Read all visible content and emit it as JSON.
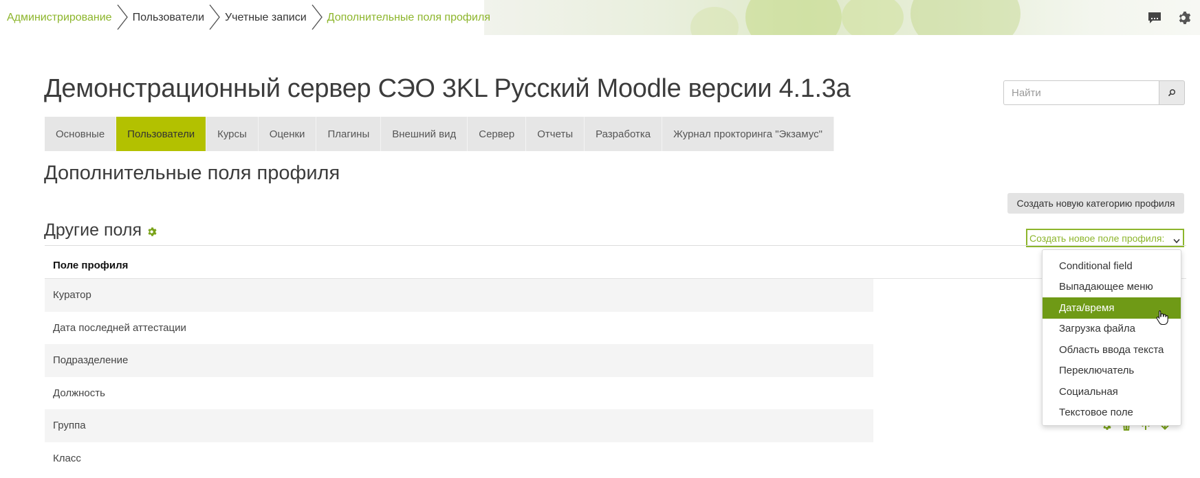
{
  "breadcrumb": {
    "items": [
      {
        "label": "Администрирование"
      },
      {
        "label": "Пользователи"
      },
      {
        "label": "Учетные записи"
      },
      {
        "label": "Дополнительные поля профиля"
      }
    ]
  },
  "site_title": "Демонстрационный сервер СЭО 3KL Русский Moodle версии 4.1.3a",
  "search": {
    "placeholder": "Найти"
  },
  "nav": {
    "tabs": [
      {
        "label": "Основные"
      },
      {
        "label": "Пользователи"
      },
      {
        "label": "Курсы"
      },
      {
        "label": "Оценки"
      },
      {
        "label": "Плагины"
      },
      {
        "label": "Внешний вид"
      },
      {
        "label": "Сервер"
      },
      {
        "label": "Отчеты"
      },
      {
        "label": "Разработка"
      },
      {
        "label": "Журнал прокторинга \"Экзамус\""
      }
    ],
    "active_tab": "Пользователи"
  },
  "page_heading": "Дополнительные поля профиля",
  "create_category_button": "Создать новую категорию профиля",
  "category": {
    "title": "Другие поля"
  },
  "create_field_select": {
    "value": "Создать новое поле профиля:",
    "options": [
      "Conditional field",
      "Выпадающее меню",
      "Дата/время",
      "Загрузка файла",
      "Область ввода текста",
      "Переключатель",
      "Социальная",
      "Текстовое поле"
    ],
    "highlighted": "Дата/время"
  },
  "table": {
    "header": "Поле профиля",
    "rows": [
      "Куратор",
      "Дата последней аттестации",
      "Подразделение",
      "Должность",
      "Группа",
      "Класс"
    ]
  },
  "colors": {
    "accent_green": "#8cb52b",
    "active_tab": "#b3c100",
    "dropdown_highlight": "#6f9a16",
    "icon_green": "#7aa31a"
  }
}
